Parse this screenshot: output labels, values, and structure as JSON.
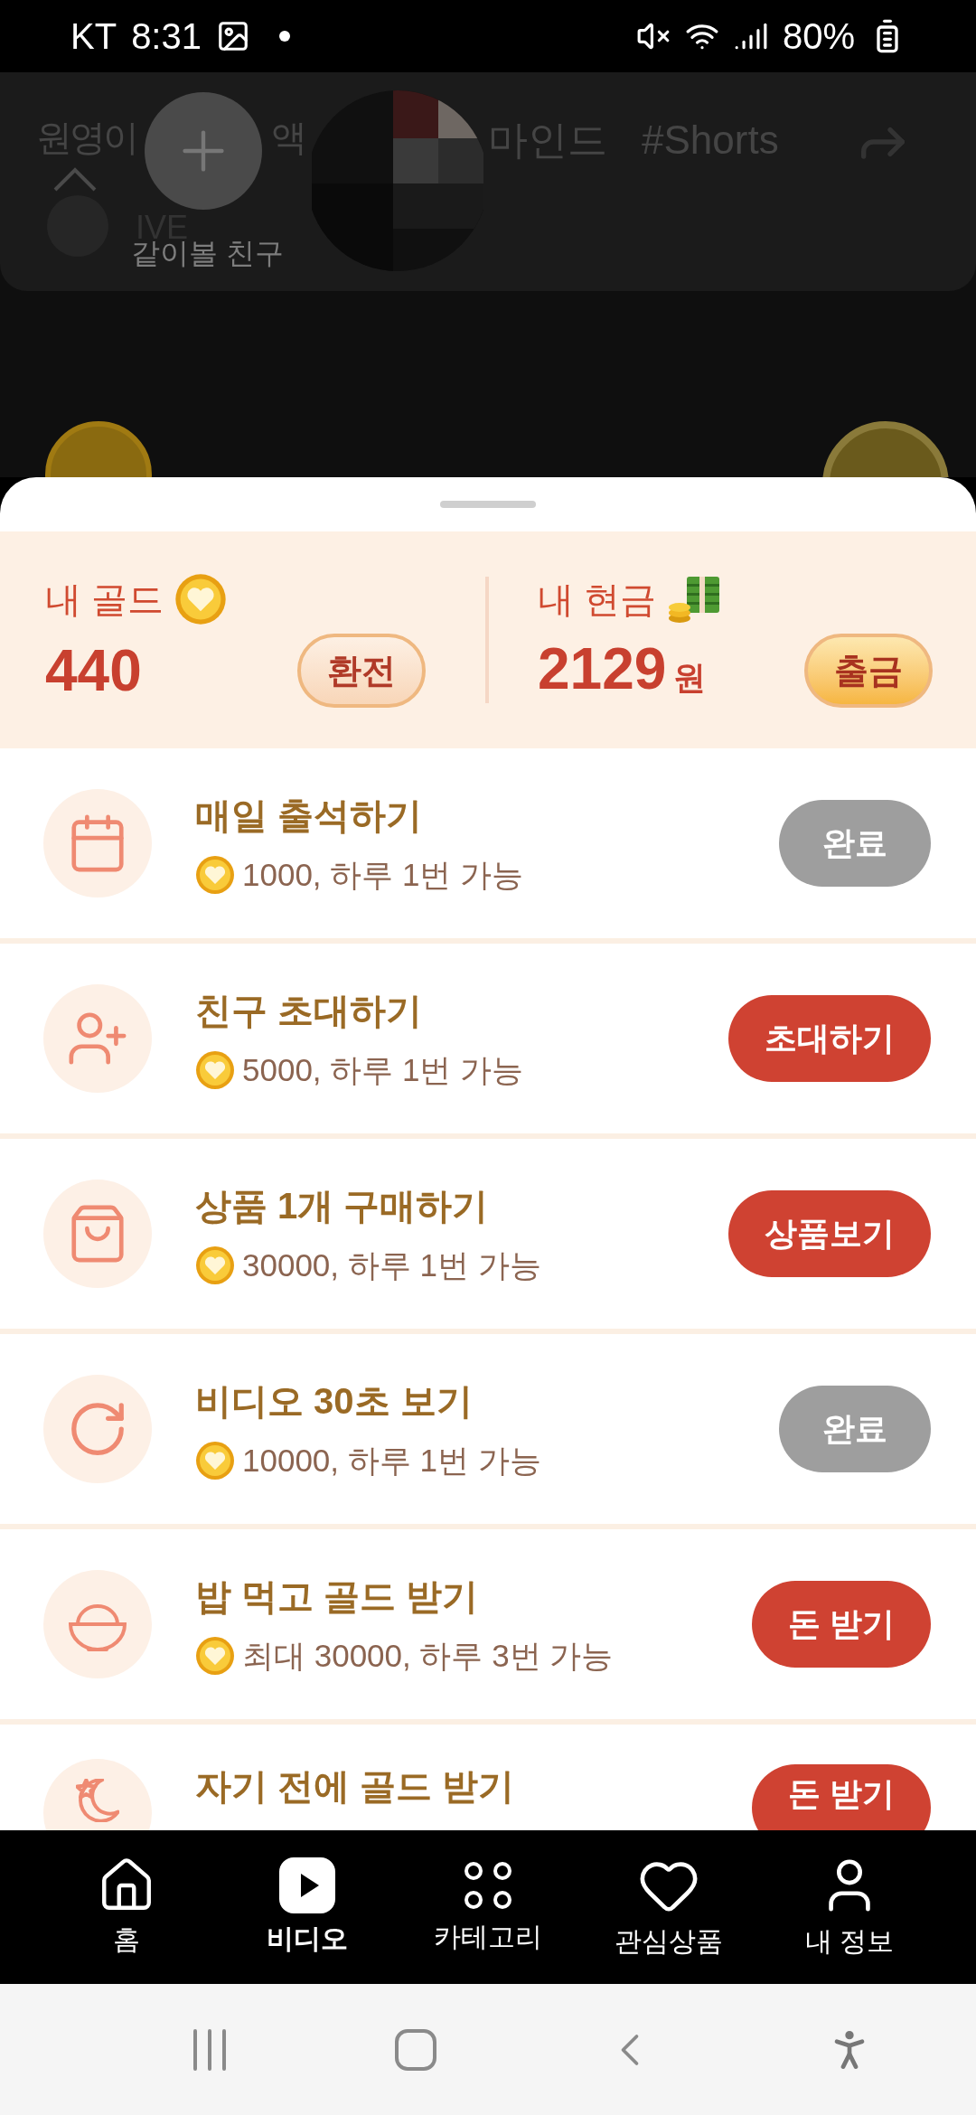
{
  "status_bar": {
    "carrier": "KT",
    "time": "8:31",
    "battery": "80%"
  },
  "video_overlay": {
    "title_start": "원영이",
    "title_mid": "액",
    "title_end": "마인드",
    "hashtag": "#Shorts",
    "channel": "IVE",
    "add_friend_label": "같이볼 친구"
  },
  "wallet": {
    "gold_label": "내 골드",
    "gold_value": "440",
    "exchange_button": "환전",
    "cash_label": "내 현금",
    "cash_value": "2129",
    "cash_unit": "원",
    "withdraw_button": "출금"
  },
  "tasks": [
    {
      "kind": "calendar",
      "title": "매일 출석하기",
      "reward": "1000, 하루 1번 가능",
      "button": "완료",
      "done": true
    },
    {
      "kind": "invite",
      "title": "친구 초대하기",
      "reward": "5000, 하루 1번 가능",
      "button": "초대하기",
      "done": false
    },
    {
      "kind": "bag",
      "title": "상품 1개 구매하기",
      "reward": "30000, 하루 1번 가능",
      "button": "상품보기",
      "done": false
    },
    {
      "kind": "timer",
      "title": "비디오 30초 보기",
      "reward": "10000, 하루 1번 가능",
      "button": "완료",
      "done": true
    },
    {
      "kind": "meal",
      "title": "밥 먹고 골드 받기",
      "reward": "최대 30000, 하루 3번 가능",
      "button": "돈 받기",
      "done": false
    },
    {
      "kind": "sleep",
      "title": "자기 전에 골드 받기",
      "button": "돈 받기",
      "done": false
    }
  ],
  "bottom_nav": [
    {
      "kind": "home",
      "label": "홈",
      "selected": false
    },
    {
      "kind": "video",
      "label": "비디오",
      "selected": true
    },
    {
      "kind": "category",
      "label": "카테고리",
      "selected": false
    },
    {
      "kind": "favorite",
      "label": "관심상품",
      "selected": false
    },
    {
      "kind": "profile",
      "label": "내 정보",
      "selected": false
    }
  ]
}
